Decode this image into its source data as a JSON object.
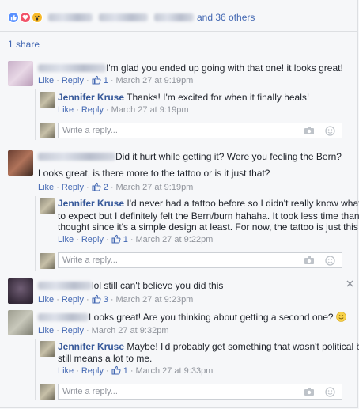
{
  "reactions": {
    "icons": [
      "like-icon",
      "love-icon",
      "wow-icon"
    ],
    "others_text": "and 36 others"
  },
  "shares": "1 share",
  "comments": [
    {
      "text": "I'm glad you ended up going with that one! it looks great!",
      "like": "Like",
      "reply": "Reply",
      "likes": "1",
      "time": "March 27 at 9:19pm",
      "replies": [
        {
          "name": "Jennifer Kruse",
          "text": "Thanks! I'm excited for when it finally heals!",
          "like": "Like",
          "reply": "Reply",
          "time": "March 27 at 9:19pm"
        }
      ]
    },
    {
      "text_line1": "Did it hurt while getting it? Were you feeling the Bern?",
      "text_line2": "Looks great, is there more to the tattoo or is it just that?",
      "like": "Like",
      "reply": "Reply",
      "likes": "2",
      "time": "March 27 at 9:19pm",
      "replies": [
        {
          "name": "Jennifer Kruse",
          "text_l1": "I'd never had a tattoo before so I didn't really know what",
          "text_l2": "to expect but I definitely felt the Bern/burn hahaha. It took less time than I",
          "text_l3": "thought since it's a simple design at least. For now, the tattoo is just this",
          "like": "Like",
          "reply": "Reply",
          "likes": "1",
          "time": "March 27 at 9:22pm"
        }
      ]
    },
    {
      "text": "lol still can't believe you did this",
      "like": "Like",
      "reply": "Reply",
      "likes": "3",
      "time": "March 27 at 9:23pm"
    },
    {
      "text": "Looks great! Are you thinking about getting a second one?",
      "like": "Like",
      "reply": "Reply",
      "time": "March 27 at 9:32pm",
      "replies": [
        {
          "name": "Jennifer Kruse",
          "text_l1": "Maybe! I'd probably get something that wasn't political but",
          "text_l2": "still means a lot to me.",
          "like": "Like",
          "reply": "Reply",
          "likes": "1",
          "time": "March 27 at 9:33pm"
        }
      ]
    }
  ],
  "reply_box": {
    "placeholder": "Write a reply..."
  },
  "icons": {
    "camera": "camera-icon",
    "emoji": "emoji-icon",
    "close": "close-icon",
    "thumbs_up": "thumbs-up-icon"
  },
  "colors": {
    "link": "#4267b2",
    "name": "#365899",
    "meta": "#90949c"
  }
}
